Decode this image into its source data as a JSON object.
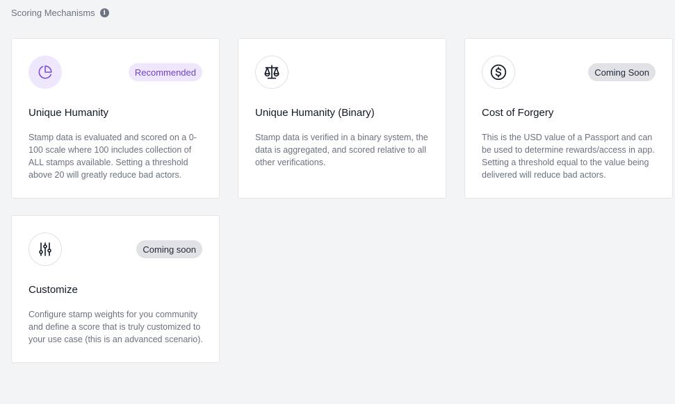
{
  "section": {
    "title": "Scoring Mechanisms",
    "info_icon": "info-icon"
  },
  "cards": [
    {
      "title": "Unique Humanity",
      "badge": "Recommended",
      "icon": "pie-chart-icon",
      "description": "Stamp data is evaluated and scored on a 0-100 scale where 100 includes collection of ALL stamps available. Setting a threshold above 20 will greatly reduce bad actors."
    },
    {
      "title": "Unique Humanity (Binary)",
      "badge": "",
      "icon": "scale-icon",
      "description": "Stamp data is verified in a binary system, the data is aggregated, and scored relative to all other verifications."
    },
    {
      "title": "Cost of Forgery",
      "badge": "Coming Soon",
      "icon": "dollar-icon",
      "description": "This is the USD value of a Passport and can be used to determine rewards/access in app. Setting a threshold equal to the value being delivered will reduce bad actors."
    },
    {
      "title": "Customize",
      "badge": "Coming soon",
      "icon": "sliders-icon",
      "description": "Configure stamp weights for you community and define a score that is truly customized to your use case (this is an advanced scenario)."
    }
  ],
  "colors": {
    "background": "#f3f4f6",
    "accent_purple": "#6d43c4",
    "badge_purple_bg": "#efe7fd",
    "badge_gray_bg": "#e1e2e6"
  }
}
